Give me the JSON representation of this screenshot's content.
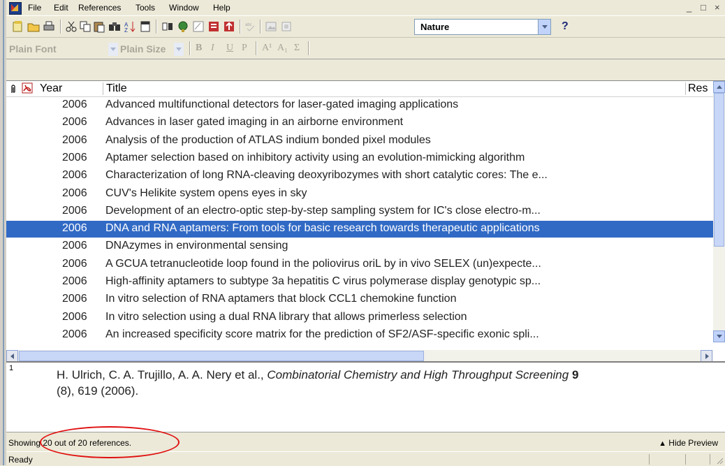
{
  "menubar": {
    "items": [
      "File",
      "Edit",
      "References",
      "Tools",
      "Window",
      "Help"
    ],
    "window_controls": [
      "_",
      "□",
      "×"
    ]
  },
  "toolbar": {
    "style_value": "Nature",
    "help_label": "?"
  },
  "format_bar": {
    "font_value": "Plain Font",
    "size_value": "Plain Size",
    "bold": "B",
    "italic": "I",
    "underline": "U",
    "plain": "P",
    "superscript": "A¹",
    "subscript": "A₁",
    "symbol": "Σ"
  },
  "list": {
    "columns": {
      "year": "Year",
      "title": "Title",
      "rest": "Res"
    },
    "rows": [
      {
        "year": "2006",
        "title": "Advanced multifunctional detectors for laser-gated imaging applications"
      },
      {
        "year": "2006",
        "title": "Advances in laser gated imaging in an airborne environment"
      },
      {
        "year": "2006",
        "title": "Analysis of the production of ATLAS indium bonded pixel modules"
      },
      {
        "year": "2006",
        "title": "Aptamer selection based on inhibitory activity using an evolution-mimicking algorithm"
      },
      {
        "year": "2006",
        "title": "Characterization of long RNA-cleaving deoxyribozymes with short catalytic cores: The e..."
      },
      {
        "year": "2006",
        "title": "CUV's Helikite system opens eyes in sky"
      },
      {
        "year": "2006",
        "title": "Development of an electro-optic step-by-step sampling system for IC's close electro-m..."
      },
      {
        "year": "2006",
        "title": "DNA and RNA aptamers: From tools for basic research towards therapeutic applications",
        "selected": true
      },
      {
        "year": "2006",
        "title": "DNAzymes in environmental sensing"
      },
      {
        "year": "2006",
        "title": "A GCUA tetranucleotide loop found in the poliovirus oriL by in vivo SELEX (un)expecte..."
      },
      {
        "year": "2006",
        "title": "High-affinity aptamers to subtype 3a hepatitis C virus polymerase display genotypic sp..."
      },
      {
        "year": "2006",
        "title": "In vitro selection of RNA aptamers that block CCL1 chemokine function"
      },
      {
        "year": "2006",
        "title": "In vitro selection using a dual RNA library that allows primerless selection"
      },
      {
        "year": "2006",
        "title": "An increased specificity score matrix for the prediction of SF2/ASF-specific exonic spli..."
      }
    ]
  },
  "preview": {
    "number": "1",
    "authors": "H. Ulrich, C. A. Trujillo, A. A. Nery et al., ",
    "journal": "Combinatorial Chemistry and High Throughput Screening",
    "volume": " 9",
    "rest": "(8), 619 (2006)."
  },
  "footer": {
    "showing": "Showing 20 out of 20 references.",
    "hide_preview": "Hide Preview",
    "status": "Ready"
  },
  "colors": {
    "selection": "#316ac5",
    "annotation": "#e01010"
  }
}
